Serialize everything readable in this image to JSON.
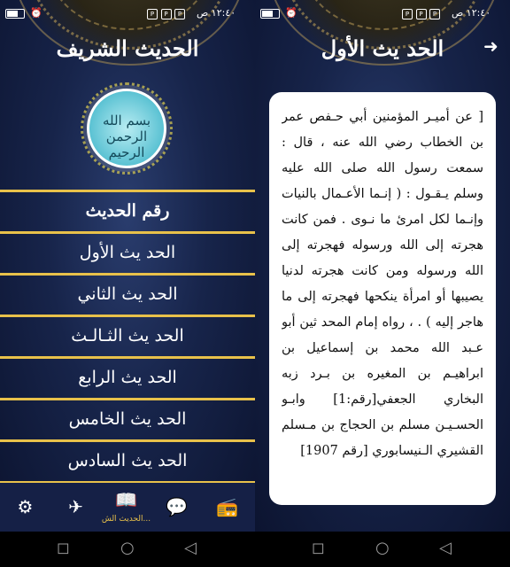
{
  "status_bar": {
    "time": "١٢:٤٠ ص",
    "battery": "",
    "icons": [
      "battery-icon",
      "alarm-icon",
      "notification-icon"
    ]
  },
  "left_screen": {
    "title": "الحديث الشريف",
    "emblem_text": "بسم الله الرحمن الرحيم",
    "list_header": "رقم الحديث",
    "items": [
      "الحد يث الأول",
      "الحد يث الثاني",
      "الحد يث الثـالـث",
      "الحد يث الرابع",
      "الحد يث الخامس",
      "الحد يث السادس"
    ],
    "bottom_nav": {
      "items": [
        {
          "icon": "settings-icon",
          "label": ""
        },
        {
          "icon": "bookmark-icon",
          "label": ""
        },
        {
          "icon": "book-icon",
          "label": "الحديث الش..."
        },
        {
          "icon": "chat-icon",
          "label": ""
        },
        {
          "icon": "radio-icon",
          "label": ""
        }
      ]
    }
  },
  "right_screen": {
    "title": "الحد يث الأول",
    "back_icon": "arrow-right-icon",
    "text": "[ عن أميـر المؤمنين أبي حـفص عمر بن الخطاب رضي الله عنه ، قال : سمعت رسول الله صلى الله عليه وسلم يـقـول : ( إنـما الأعـمال بالنيات وإنـما لكل امرئ ما نـوى . فمن كانت هجرته إلى الله ورسوله فهجرته إلى الله ورسوله ومن كانت هجرته لدنيا يصيبها أو امرأة ينكحها فهجرته إلى ما هاجر إليه ) . ، رواه إمام المحد ثين أبو عـبد الله محمد بن إسماعيل بن ابراهيـم بن المغيره بن بـرد زبه البخاري الجعفي[رقم:1] وابـو الحسـيـن مسلم بن الحجاج بن مـسلم القشيري الـنيسابوري [رقم 1907] "
  },
  "colors": {
    "accent": "#e8c14a",
    "background": "#17244a",
    "card": "#ffffff"
  }
}
